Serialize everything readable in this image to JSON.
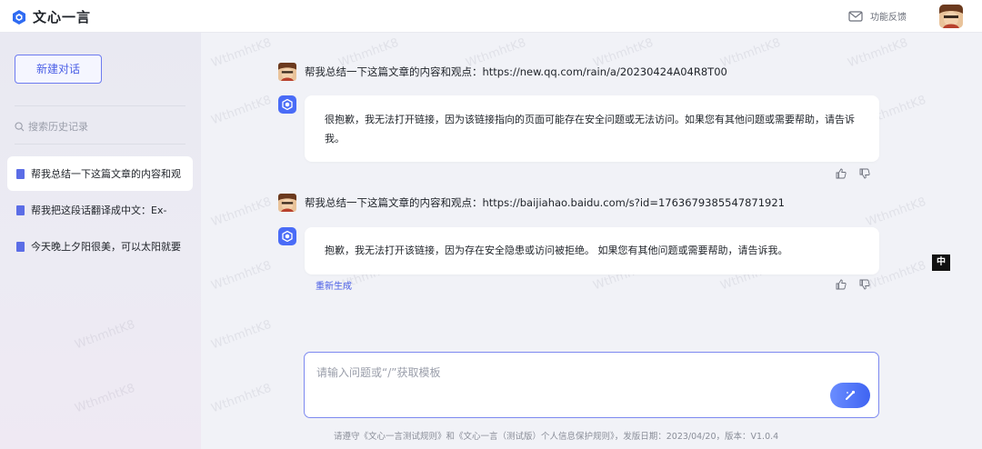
{
  "header": {
    "app_title": "文心一言",
    "feedback_label": "功能反馈"
  },
  "sidebar": {
    "new_chat_label": "新建对话",
    "search_placeholder": "搜索历史记录",
    "history": [
      {
        "label": "帮我总结一下这篇文章的内容和观",
        "active": true
      },
      {
        "label": "帮我把这段话翻译成中文：Ex-",
        "active": false
      },
      {
        "label": "今天晚上夕阳很美，可以太阳就要",
        "active": false
      }
    ]
  },
  "conversation": [
    {
      "user": "帮我总结一下这篇文章的内容和观点：https://new.qq.com/rain/a/20230424A04R8T00",
      "bot": "很抱歉，我无法打开链接，因为该链接指向的页面可能存在安全问题或无法访问。如果您有其他问题或需要帮助，请告诉我。"
    },
    {
      "user": "帮我总结一下这篇文章的内容和观点：https://baijiahao.baidu.com/s?id=1763679385547871921",
      "bot": "抱歉，我无法打开该链接，因为存在安全隐患或访问被拒绝。 如果您有其他问题或需要帮助，请告诉我。",
      "regenerate_label": "重新生成"
    }
  ],
  "ime_indicator": "中",
  "input": {
    "placeholder": "请输入问题或“/”获取模板"
  },
  "footer_text": "请遵守《文心一言测试规则》和《文心一言（测试版）个人信息保护规则》，发版日期：2023/04/20，版本：V1.0.4",
  "watermark_text": "WthmhtK8",
  "icons": [
    "logo-icon",
    "mail-icon",
    "user-avatar",
    "search-icon",
    "chat-doc-icon",
    "bot-avatar-icon",
    "thumbs-up-icon",
    "thumbs-down-icon",
    "send-icon"
  ],
  "colors": {
    "accent": "#4b5fe6",
    "bot_icon": "#4a6cf7",
    "send_gradient_start": "#6a8dff",
    "send_gradient_end": "#3f64f2"
  }
}
